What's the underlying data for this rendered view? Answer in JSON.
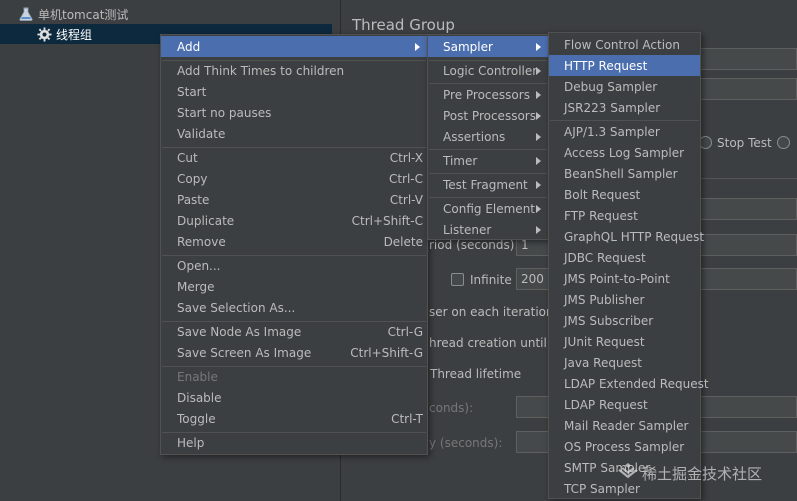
{
  "tree": {
    "items": [
      {
        "label": "单机tomcat测试",
        "icon": "flask-icon"
      },
      {
        "label": "线程组",
        "icon": "gear-icon"
      }
    ]
  },
  "editor": {
    "title": "Thread Group",
    "stop_test": "Stop Test",
    "period_label": "riod (seconds):",
    "period_value": "1",
    "infinite_label": "Infinite",
    "loop_value": "200",
    "same_user": "ser on each iteration",
    "delay_thread": "hread creation until ne",
    "thread_lifetime": "Thread lifetime",
    "duration_label": "conds):",
    "startup_delay_label": "y (seconds):"
  },
  "context_menu": {
    "items": [
      {
        "label": "Add",
        "submenu": true,
        "active": true
      },
      {
        "separator": true
      },
      {
        "label": "Add Think Times to children"
      },
      {
        "label": "Start"
      },
      {
        "label": "Start no pauses"
      },
      {
        "label": "Validate"
      },
      {
        "separator": true
      },
      {
        "label": "Cut",
        "shortcut": "Ctrl-X"
      },
      {
        "label": "Copy",
        "shortcut": "Ctrl-C"
      },
      {
        "label": "Paste",
        "shortcut": "Ctrl-V"
      },
      {
        "label": "Duplicate",
        "shortcut": "Ctrl+Shift-C"
      },
      {
        "label": "Remove",
        "shortcut": "Delete"
      },
      {
        "separator": true
      },
      {
        "label": "Open..."
      },
      {
        "label": "Merge"
      },
      {
        "label": "Save Selection As..."
      },
      {
        "separator": true
      },
      {
        "label": "Save Node As Image",
        "shortcut": "Ctrl-G"
      },
      {
        "label": "Save Screen As Image",
        "shortcut": "Ctrl+Shift-G"
      },
      {
        "separator": true
      },
      {
        "label": "Enable",
        "disabled": true
      },
      {
        "label": "Disable"
      },
      {
        "label": "Toggle",
        "shortcut": "Ctrl-T"
      },
      {
        "separator": true
      },
      {
        "label": "Help"
      }
    ]
  },
  "add_submenu": {
    "items": [
      {
        "label": "Sampler",
        "submenu": true,
        "active": true
      },
      {
        "separator": true
      },
      {
        "label": "Logic Controller",
        "submenu": true
      },
      {
        "separator": true
      },
      {
        "label": "Pre Processors",
        "submenu": true
      },
      {
        "label": "Post Processors",
        "submenu": true
      },
      {
        "label": "Assertions",
        "submenu": true
      },
      {
        "separator": true
      },
      {
        "label": "Timer",
        "submenu": true
      },
      {
        "separator": true
      },
      {
        "label": "Test Fragment",
        "submenu": true
      },
      {
        "separator": true
      },
      {
        "label": "Config Element",
        "submenu": true
      },
      {
        "label": "Listener",
        "submenu": true
      }
    ]
  },
  "sampler_submenu": {
    "items": [
      {
        "label": "Flow Control Action"
      },
      {
        "label": "HTTP Request",
        "active": true
      },
      {
        "label": "Debug Sampler"
      },
      {
        "label": "JSR223 Sampler"
      },
      {
        "separator": true
      },
      {
        "label": "AJP/1.3 Sampler"
      },
      {
        "label": "Access Log Sampler"
      },
      {
        "label": "BeanShell Sampler"
      },
      {
        "label": "Bolt Request"
      },
      {
        "label": "FTP Request"
      },
      {
        "label": "GraphQL HTTP Request"
      },
      {
        "label": "JDBC Request"
      },
      {
        "label": "JMS Point-to-Point"
      },
      {
        "label": "JMS Publisher"
      },
      {
        "label": "JMS Subscriber"
      },
      {
        "label": "JUnit Request"
      },
      {
        "label": "Java Request"
      },
      {
        "label": "LDAP Extended Request"
      },
      {
        "label": "LDAP Request"
      },
      {
        "label": "Mail Reader Sampler"
      },
      {
        "label": "OS Process Sampler"
      },
      {
        "label": "SMTP Sampler"
      },
      {
        "label": "TCP Sampler"
      }
    ]
  },
  "watermark": {
    "text": "稀土掘金技术社区",
    "icon": "juejin-logo-icon"
  },
  "colors": {
    "highlight": "#4b6eaf",
    "background": "#3c3f41",
    "selected_row": "#0d293e"
  }
}
